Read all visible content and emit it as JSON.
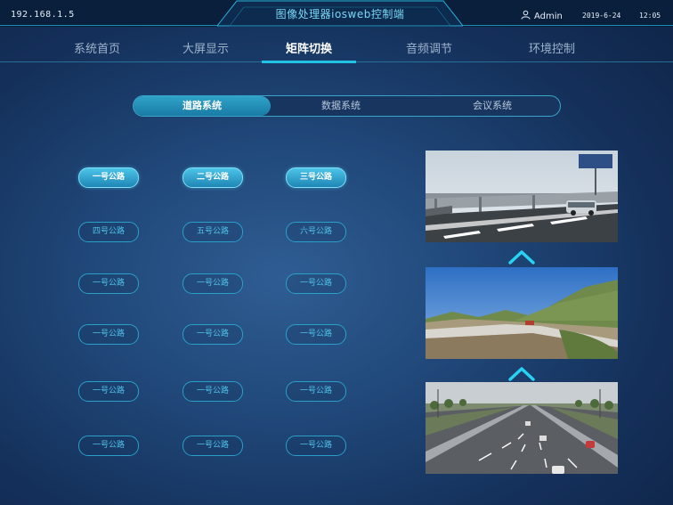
{
  "topbar": {
    "ip": "192.168.1.5",
    "title": "图像处理器iosweb控制端",
    "user_name": "Admin",
    "date": "2019-6-24",
    "time": "12:05"
  },
  "nav": {
    "items": [
      {
        "label": "系统首页"
      },
      {
        "label": "大屏显示"
      },
      {
        "label": "矩阵切换",
        "active": true
      },
      {
        "label": "音频调节"
      },
      {
        "label": "环境控制"
      }
    ]
  },
  "segments": {
    "items": [
      {
        "label": "道路系统",
        "active": true
      },
      {
        "label": "数据系统"
      },
      {
        "label": "会议系统"
      }
    ]
  },
  "roads": [
    {
      "label": "一号公路",
      "active": true
    },
    {
      "label": "二号公路",
      "active": true
    },
    {
      "label": "三号公路",
      "active": true
    },
    {
      "label": "四号公路"
    },
    {
      "label": "五号公路"
    },
    {
      "label": "六号公路"
    },
    {
      "label": "一号公路"
    },
    {
      "label": "一号公路"
    },
    {
      "label": "一号公路"
    },
    {
      "label": "一号公路"
    },
    {
      "label": "一号公路"
    },
    {
      "label": "一号公路"
    },
    {
      "label": "一号公路"
    },
    {
      "label": "一号公路"
    },
    {
      "label": "一号公路"
    },
    {
      "label": "一号公路"
    },
    {
      "label": "一号公路"
    },
    {
      "label": "一号公路"
    }
  ],
  "colors": {
    "accent": "#21c2e6",
    "background": "#1f4677",
    "topbar": "#0a1f3c"
  },
  "icons": {
    "user": "user-icon",
    "move_up": "chevron-up-icon"
  }
}
